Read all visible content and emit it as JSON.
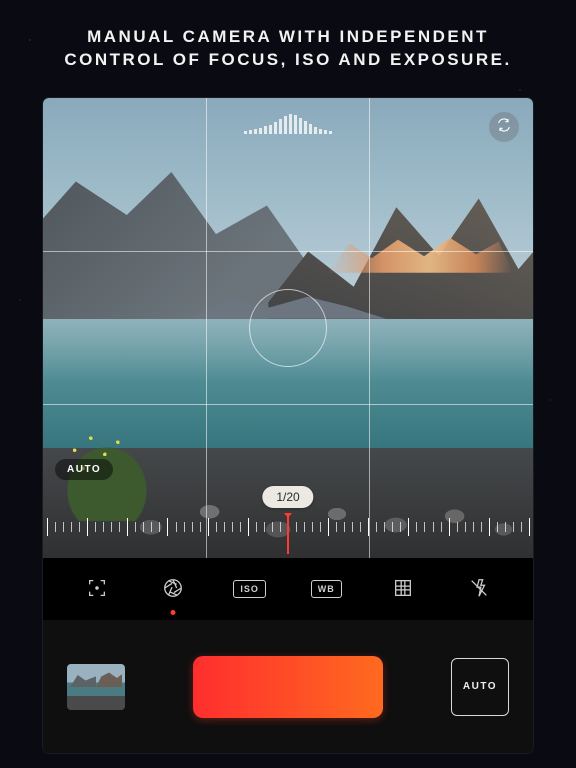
{
  "headline_line1": "MANUAL CAMERA WITH INDEPENDENT",
  "headline_line2": "CONTROL OF FOCUS, ISO AND EXPOSURE.",
  "viewfinder": {
    "auto_badge": "AUTO",
    "shutter_value": "1/20",
    "flip_icon": "camera-flip-icon",
    "histogram_bars": [
      3,
      4,
      5,
      6,
      8,
      9,
      12,
      15,
      18,
      20,
      19,
      16,
      13,
      10,
      7,
      5,
      4,
      3
    ]
  },
  "toolbar": {
    "items": [
      {
        "name": "focus",
        "kind": "icon"
      },
      {
        "name": "shutter",
        "kind": "icon",
        "active": true
      },
      {
        "name": "iso",
        "kind": "boxtext",
        "label": "ISO"
      },
      {
        "name": "wb",
        "kind": "boxtext",
        "label": "WB"
      },
      {
        "name": "grid",
        "kind": "icon"
      },
      {
        "name": "flash-off",
        "kind": "icon"
      }
    ]
  },
  "bottombar": {
    "thumbnail": "last-capture-thumbnail",
    "record": "record-button",
    "mode_label": "AUTO"
  },
  "colors": {
    "accent": "#ff3b2f",
    "record_gradient_start": "#ff2e2e",
    "record_gradient_end": "#ff6a1f"
  }
}
